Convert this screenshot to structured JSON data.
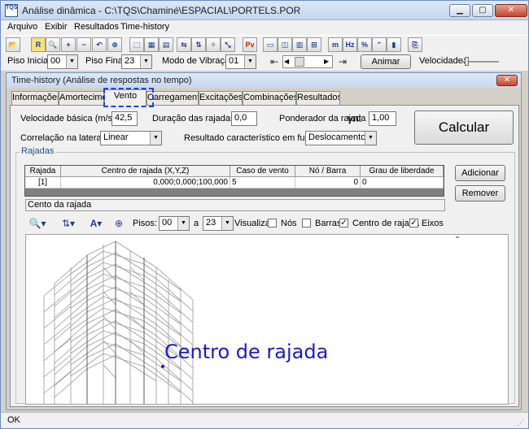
{
  "window": {
    "title": "Análise dinâmica - C:\\TQS\\Chaminé\\ESPACIAL\\PORTELS.POR",
    "icon_text": "TQS"
  },
  "caption_buttons": {
    "minimize": "▁",
    "maximize": "▢",
    "close": "✕"
  },
  "menu": [
    "Arquivo",
    "Exibir",
    "Resultados",
    "Time-history"
  ],
  "toolbar_icons": [
    {
      "name": "open-icon",
      "glyph": "📂"
    },
    {
      "name": "report-icon",
      "glyph": "R"
    },
    {
      "name": "zoom-window-icon",
      "glyph": "🔍"
    },
    {
      "name": "zoom-in-icon",
      "glyph": "+"
    },
    {
      "name": "zoom-out-icon",
      "glyph": "−"
    },
    {
      "name": "zoom-prev-icon",
      "glyph": "↶"
    },
    {
      "name": "zoom-all-icon",
      "glyph": "⊕"
    },
    {
      "name": "view-3d-icon",
      "glyph": "⬚"
    },
    {
      "name": "view-solid-icon",
      "glyph": "▦"
    },
    {
      "name": "view-table-icon",
      "glyph": "▤"
    },
    {
      "name": "axes-x-icon",
      "glyph": "⇆"
    },
    {
      "name": "axes-y-icon",
      "glyph": "⇅"
    },
    {
      "name": "axes-z-icon",
      "glyph": "✧"
    },
    {
      "name": "axes-iso-icon",
      "glyph": "⤡"
    },
    {
      "name": "pv-icon",
      "glyph": "Pv"
    },
    {
      "name": "window-1-icon",
      "glyph": "▭"
    },
    {
      "name": "window-2-icon",
      "glyph": "◫"
    },
    {
      "name": "window-3-icon",
      "glyph": "▥"
    },
    {
      "name": "window-4-icon",
      "glyph": "⊞"
    },
    {
      "name": "mode-icon",
      "glyph": "m"
    },
    {
      "name": "hz-icon",
      "glyph": "Hz"
    },
    {
      "name": "percent-icon",
      "glyph": "%"
    },
    {
      "name": "peak-icon",
      "glyph": "⌃"
    },
    {
      "name": "bars-icon",
      "glyph": "▮"
    },
    {
      "name": "export-icon",
      "glyph": "⎘"
    }
  ],
  "params": {
    "piso_inicial_label": "Piso Inicial:",
    "piso_inicial": "00",
    "piso_final_label": "Piso Final:",
    "piso_final": "23",
    "modo_label": "Modo de Vibração:",
    "modo": "01",
    "animar": "Animar",
    "velocidade_label": "Velocidade:"
  },
  "child": {
    "title": "Time-history (Análise de respostas no tempo)",
    "close": "✕",
    "tabs": [
      "Informações",
      "Amortecimento",
      "Vento",
      "Carregamentos",
      "Excitações",
      "Combinações",
      "Resultados"
    ],
    "active_tab": "Vento"
  },
  "vento": {
    "vel_basica_label": "Velocidade básica (m/s):",
    "vel_basica": "42,5",
    "duracao_label": "Duração das rajadas (s):",
    "duracao": "0,0",
    "ponderador_label": "Ponderador da rajada",
    "ponderador_symbol": "γn:",
    "ponderador": "1,00",
    "correlacao_label": "Correlação na lateral:",
    "correlacao": "Linear",
    "resultado_label": "Resultado característico em função:",
    "resultado": "Deslocamento",
    "calcular": "Calcular"
  },
  "rajadas": {
    "group_label": "Rajadas",
    "columns": [
      "Rajada",
      "Centro de rajada (X,Y,Z)",
      "Caso de vento",
      "Nó / Barra",
      "Grau de liberdade"
    ],
    "rows": [
      [
        "[1]",
        "0,000;0,000;100,000",
        "5",
        "0",
        "0"
      ]
    ],
    "adicionar": "Adicionar",
    "remover": "Remover",
    "status": "Cento da rajada"
  },
  "view_toolbar": {
    "pisos_label": "Pisos:",
    "piso_de": "00",
    "a_label": "a",
    "piso_ate": "23",
    "visualizar_label": "Visualizar:",
    "checks": [
      {
        "label": "Nós",
        "checked": false
      },
      {
        "label": "Barras",
        "checked": false
      },
      {
        "label": "Centro de rajada",
        "checked": true
      },
      {
        "label": "Eixos",
        "checked": true
      }
    ]
  },
  "view3d": {
    "center_label": "Centro de rajada"
  },
  "statusbar": {
    "text": "OK"
  },
  "colors": {
    "accent": "#1a1acc",
    "legend": "#1f4e9b",
    "pv": "#cc2200"
  }
}
